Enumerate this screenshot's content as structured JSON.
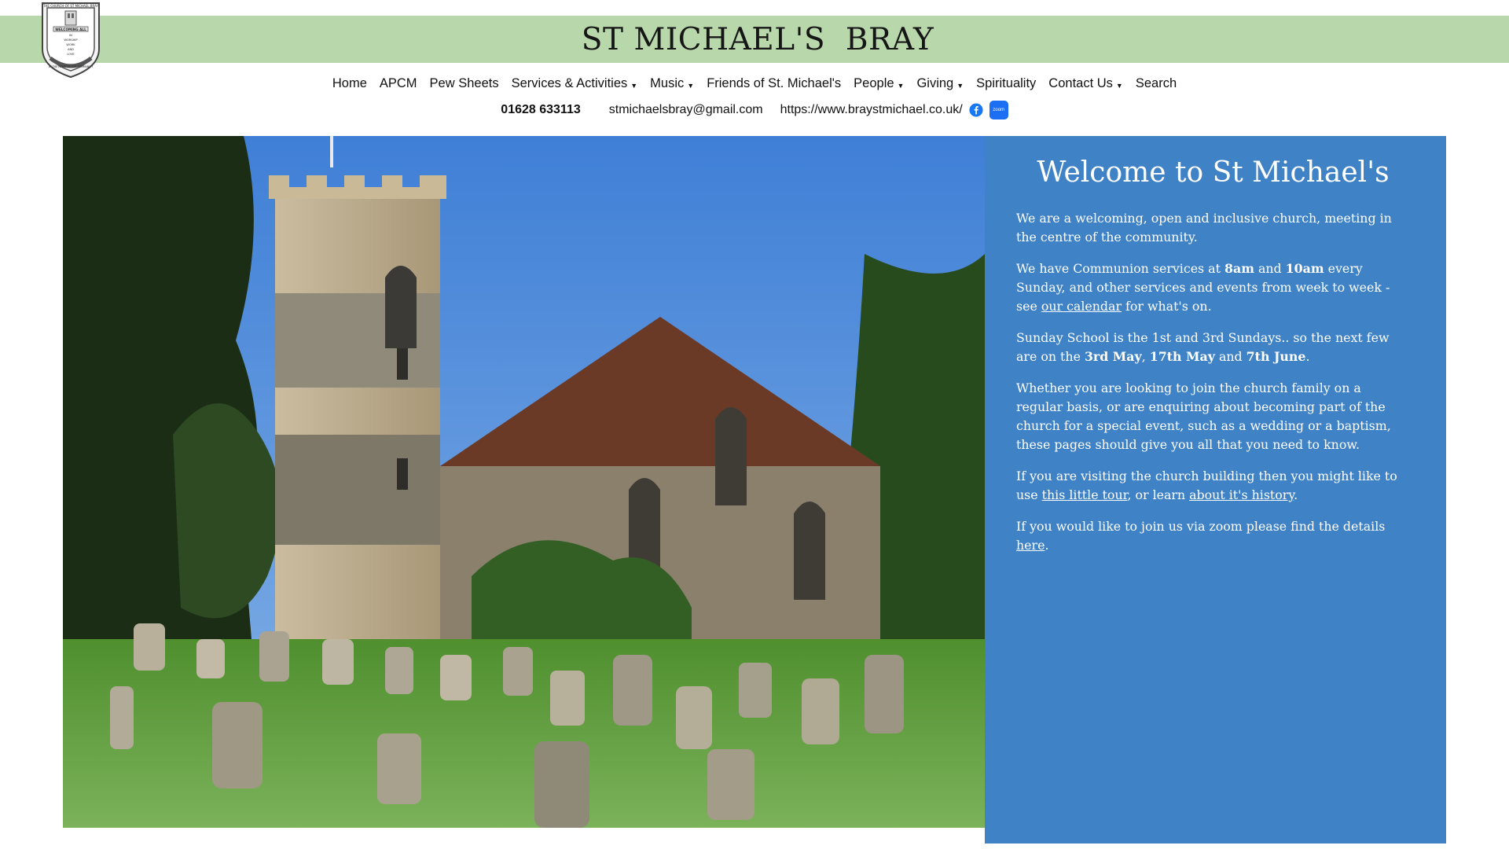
{
  "site": {
    "title": "ST MICHAEL'S  BRAY",
    "logo_text": "THE CHURCH OF ST MICHAEL BRAY",
    "logo_motto": [
      "WELCOMING ALL",
      "IN",
      "WORSHIP",
      "WORK",
      "AND",
      "LOVE"
    ],
    "logo_footer": "AT THE HEART OF THE COMMUNITY"
  },
  "nav": {
    "items": [
      {
        "label": "Home",
        "dropdown": false
      },
      {
        "label": "APCM",
        "dropdown": false
      },
      {
        "label": "Pew Sheets",
        "dropdown": false
      },
      {
        "label": "Services & Activities",
        "dropdown": true
      },
      {
        "label": "Music",
        "dropdown": true
      },
      {
        "label": "Friends of St. Michael's",
        "dropdown": false
      },
      {
        "label": "People",
        "dropdown": true
      },
      {
        "label": "Giving",
        "dropdown": true
      },
      {
        "label": "Spirituality",
        "dropdown": false
      },
      {
        "label": "Contact Us",
        "dropdown": true
      },
      {
        "label": "Search",
        "dropdown": false
      }
    ],
    "caret": "▼"
  },
  "contact": {
    "phone": "01628 633113",
    "email": "stmichaelsbray@gmail.com",
    "url": "https://www.braystmichael.co.uk/",
    "zoom_label": "zoom"
  },
  "welcome": {
    "heading": "Welcome to St Michael's",
    "p1": "We are a welcoming, open and inclusive church, meeting in the centre of the community.",
    "p2": {
      "t1": "We have Communion services at ",
      "b1": "8am",
      "t2": " and ",
      "b2": "10am",
      "t3": " every Sunday, and other services and events from week to week - see ",
      "link": "our calendar",
      "t4": " for what's on."
    },
    "p3": {
      "t1": "Sunday School is the 1st and 3rd Sundays.. so the next few are on the ",
      "b1": "3rd May",
      "t2": ", ",
      "b2": "17th May",
      "t3": " and ",
      "b3": "7th June",
      "t4": "."
    },
    "p4": "Whether you are looking to join the church family on a regular basis, or are enquiring about becoming part of the church for a special event, such as a wedding or a baptism, these pages should give you all that you need to know.",
    "p5": {
      "t1": "If you are visiting the church building then you might like to use ",
      "link1": "this little tour",
      "t2": ", or learn ",
      "link2": "about it's history",
      "t3": "."
    },
    "p6": {
      "t1": "If you would like to join us via zoom please find the details ",
      "link": "here",
      "t2": "."
    }
  },
  "colors": {
    "title_band": "#b8d8ac",
    "panel_bg": "#3f82c5",
    "zoom_blue": "#1c6ef2",
    "facebook_blue": "#1877f2"
  }
}
